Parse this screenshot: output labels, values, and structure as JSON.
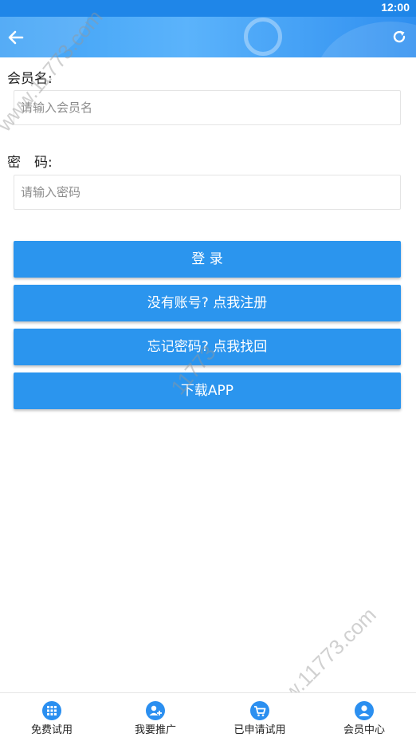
{
  "status_bar": {
    "time": "12:00"
  },
  "header": {
    "back_icon": "arrow-left-icon",
    "refresh_icon": "refresh-icon"
  },
  "form": {
    "username": {
      "label": "会员名:",
      "placeholder": "请输入会员名",
      "value": ""
    },
    "password": {
      "label": "密　码:",
      "placeholder": "请输入密码",
      "value": ""
    }
  },
  "buttons": {
    "login": "登 录",
    "register": "没有账号? 点我注册",
    "forgot": "忘记密码? 点我找回",
    "download": "下载APP"
  },
  "watermarks": [
    "www.11773.com",
    "11773",
    "www.11773.com"
  ],
  "bottom_nav": [
    {
      "label": "免费试用",
      "icon": "grid-icon"
    },
    {
      "label": "我要推广",
      "icon": "user-add-icon"
    },
    {
      "label": "已申请试用",
      "icon": "cart-icon"
    },
    {
      "label": "会员中心",
      "icon": "person-icon"
    }
  ],
  "colors": {
    "primary": "#2b95ee",
    "status_bar": "#1f86e8",
    "nav_icon": "#2b8ff0"
  }
}
